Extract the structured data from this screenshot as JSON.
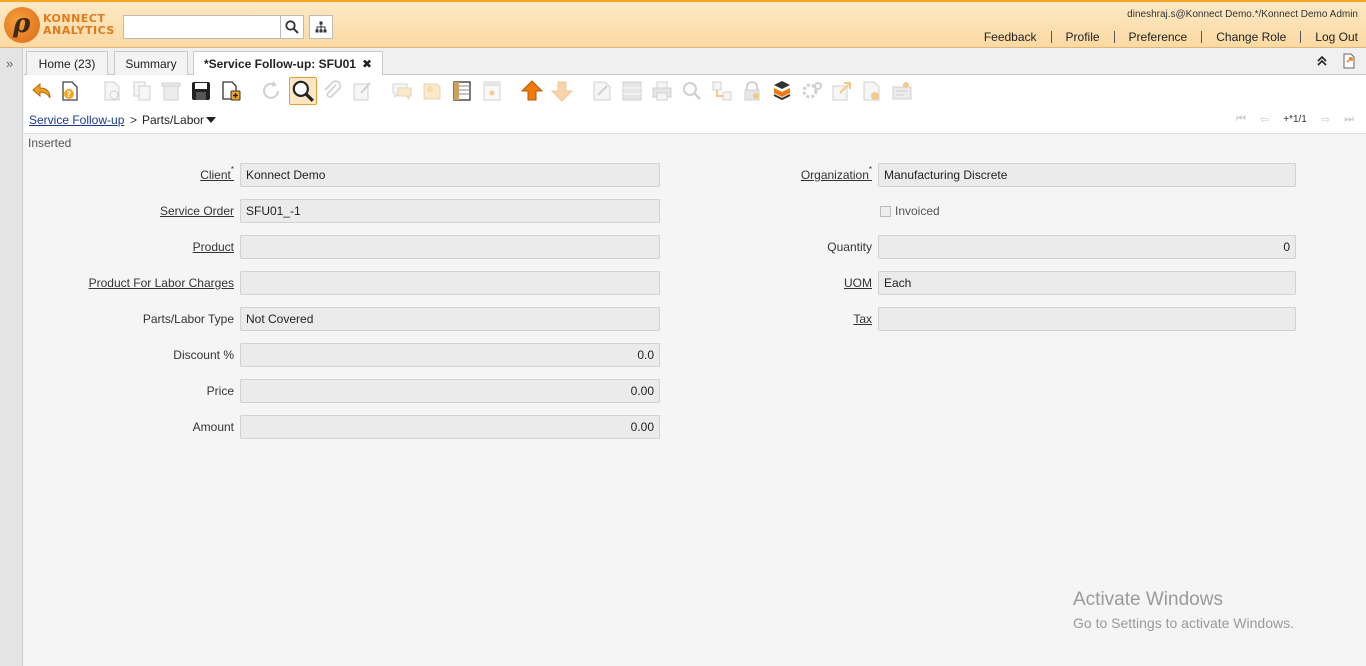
{
  "header": {
    "logo_line1": "KONNECT",
    "logo_line2": "ANALYTICS",
    "search_placeholder": "",
    "user": "dineshraj.s@Konnect Demo.*/Konnect Demo Admin",
    "links": [
      "Feedback",
      "Profile",
      "Preference",
      "Change Role",
      "Log Out"
    ]
  },
  "tabs": [
    {
      "label": "Home (23)"
    },
    {
      "label": "Summary"
    },
    {
      "label": "*Service Follow-up: SFU01",
      "close": "✖"
    }
  ],
  "breadcrumb": {
    "parent": "Service Follow-up",
    "separator": ">",
    "current": "Parts/Labor"
  },
  "record_nav": {
    "label": "+*1/1"
  },
  "form": {
    "status": "Inserted",
    "left": [
      {
        "label": "Client",
        "required": "*",
        "value": "Konnect Demo"
      },
      {
        "label": "Service Order",
        "value": "SFU01_-1"
      },
      {
        "label": "Product",
        "value": ""
      },
      {
        "label": "Product For Labor Charges",
        "value": ""
      },
      {
        "label": "Parts/Labor Type",
        "value": "Not Covered"
      },
      {
        "label": "Discount %",
        "value": "0.0"
      },
      {
        "label": "Price",
        "value": "0.00"
      },
      {
        "label": "Amount",
        "value": "0.00"
      }
    ],
    "right": {
      "organization": {
        "label": "Organization",
        "required": "*",
        "value": "Manufacturing Discrete"
      },
      "invoiced": {
        "label": "Invoiced",
        "checked": false
      },
      "quantity": {
        "label": "Quantity",
        "value": "0"
      },
      "uom": {
        "label": "UOM",
        "value": "Each"
      },
      "tax": {
        "label": "Tax",
        "value": ""
      }
    }
  },
  "watermark": {
    "line1": "Activate Windows",
    "line2": "Go to Settings to activate Windows."
  },
  "colors": {
    "accent": "#f5a623",
    "link": "#1a3a8a",
    "active_tab_border": "#e4a03b"
  }
}
